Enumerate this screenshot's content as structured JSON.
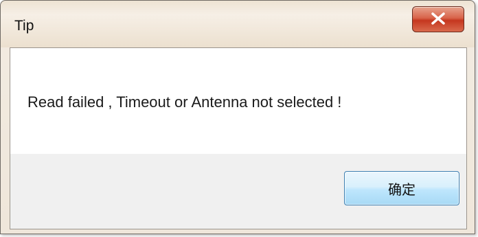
{
  "dialog": {
    "title": "Tip",
    "message": "Read failed , Timeout or Antenna not selected !",
    "ok_label": "确定",
    "close_icon": "close-x",
    "colors": {
      "close_button": "#c5371f",
      "ok_button_border": "#3c7fb1",
      "footer_background": "#f0f0f0"
    }
  }
}
